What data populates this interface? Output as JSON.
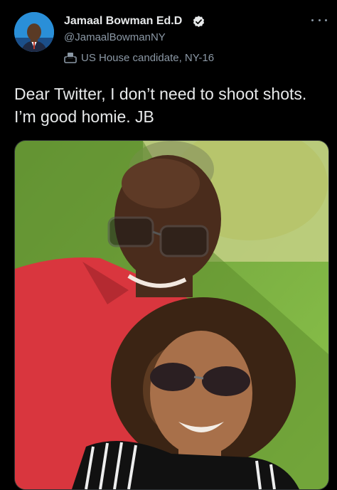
{
  "author": {
    "name": "Jamaal Bowman Ed.D",
    "handle": "@JamaalBowmanNY",
    "label": "US House candidate, NY-16",
    "avatar_icon": "profile-photo",
    "verified_icon": "verified-badge-icon",
    "label_icon": "ballot-box-icon"
  },
  "menu_icon": "more-options-icon",
  "tweet": {
    "text": "Dear Twitter, I don’t need to shoot shots. I’m good homie. JB"
  },
  "media": {
    "type": "photo",
    "description_icon": "selfie-photo"
  },
  "colors": {
    "background": "#000000",
    "text": "#e7e9ea",
    "secondary": "#8b98a5",
    "accent": "#1d9bf0"
  }
}
